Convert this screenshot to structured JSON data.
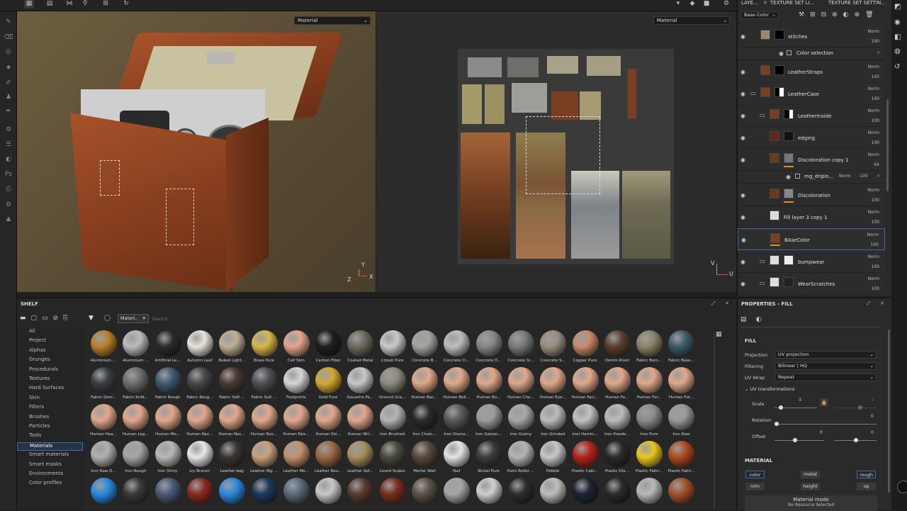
{
  "viewport3d": {
    "mode": "Material"
  },
  "viewport2d": {
    "mode": "Material"
  },
  "axis": {
    "y": "Y",
    "x": "X",
    "z": "Z",
    "u": "U",
    "v": "V"
  },
  "tabs": {
    "layers": "LAYE...",
    "tsl": "TEXTURE SET LI...",
    "tss": "TEXTURE SET SETTIN..."
  },
  "channel_select": "Base Color",
  "layers": [
    {
      "name": "stitches",
      "blend": "Norm",
      "opacity": "100"
    },
    {
      "name": "Color selection"
    },
    {
      "name": "LeatherStraps",
      "blend": "Norm",
      "opacity": "100"
    },
    {
      "name": "LeatherCase",
      "blend": "Norm",
      "opacity": "100"
    },
    {
      "name": "LeatherInside",
      "blend": "Norm",
      "opacity": "100"
    },
    {
      "name": "edging",
      "blend": "Norm",
      "opacity": "100"
    },
    {
      "name": "Discoloration copy 1",
      "blend": "Norm",
      "opacity": "64"
    },
    {
      "name": "mg_dripin...",
      "blend": "Norm",
      "opacity": "100"
    },
    {
      "name": "Discoloration",
      "blend": "Norm",
      "opacity": "100"
    },
    {
      "name": "Fill layer 3 copy 1",
      "blend": "Norm",
      "opacity": "100"
    },
    {
      "name": "BAseColor",
      "blend": "Norm",
      "opacity": "100"
    },
    {
      "name": "bumpwear",
      "blend": "Norm",
      "opacity": "100"
    },
    {
      "name": "WearScratches",
      "blend": "Norm",
      "opacity": "100"
    }
  ],
  "shelf": {
    "title": "SHELF",
    "filter_chip": "Materi..",
    "search_placeholder": "Search...",
    "categories": [
      "All",
      "Project",
      "Alphas",
      "Grunges",
      "Procedurals",
      "Textures",
      "Hard Surfaces",
      "Skin",
      "Filters",
      "Brushes",
      "Particles",
      "Tools",
      "Materials",
      "Smart materials",
      "Smart masks",
      "Environments",
      "Color profiles"
    ],
    "materials": [
      "Aluminium ...",
      "Aluminium ...",
      "Artificial Le...",
      "Autumn Leaf",
      "Baked Light...",
      "Brass Pure",
      "Calf Skin",
      "Carbon Fiber",
      "Coated Metal",
      "Cobalt Pure",
      "Concrete B...",
      "Concrete Cl...",
      "Concrete D...",
      "Concrete Si...",
      "Concrete S...",
      "Copper Pure",
      "Denim Rivet",
      "Fabric Bam...",
      "Fabric Base...",
      "Fabric Deni...",
      "Fabric Knitt...",
      "Fabric Rough",
      "Fabric Roug...",
      "Fabric Soft ...",
      "Fabric Suit ...",
      "Footprints",
      "Gold Pure",
      "Gouache Pa...",
      "Ground Gra...",
      "Human Bac...",
      "Human Bell...",
      "Human Bu...",
      "Human Che...",
      "Human Eye...",
      "Human Faci...",
      "Human Fe...",
      "Human For...",
      "Human For...",
      "Human Hea...",
      "Human Leg...",
      "Human Mo...",
      "Human Nec...",
      "Human Nec...",
      "Human Nos...",
      "Human Nos...",
      "Human Shi...",
      "Human Wri...",
      "Iron Brushed",
      "Iron Chain...",
      "Iron Diamo...",
      "Iron Galvan...",
      "Iron Grainy",
      "Iron Grinded",
      "Iron Hamm...",
      "Iron Powde...",
      "Iron Pure",
      "Iron Raw",
      "Iron Raw D...",
      "Iron Rough",
      "Iron Shiny",
      "Ivy Branch",
      "Leather bag",
      "Leather Big ...",
      "Leather Me...",
      "Leather Rou...",
      "Leather Sof...",
      "Lizard Scales",
      "Mortar Wall",
      "Nail",
      "Nickel Pure",
      "Paint Roller ...",
      "Pebble",
      "Plastic Cabl...",
      "Plastic Dia...",
      "Plastic Fabri...",
      "Plastic Fabri...",
      "",
      "",
      "",
      "",
      "",
      "",
      "",
      "",
      "",
      "",
      "",
      "",
      "",
      "",
      "",
      "",
      "",
      "",
      ""
    ]
  },
  "properties": {
    "title": "PROPERTIES - FILL",
    "fill_heading": "FILL",
    "projection_label": "Projection",
    "projection_value": "UV projection",
    "filtering_label": "Filtering",
    "filtering_value": "Bilinear | HQ",
    "uvwrap_label": "UV Wrap",
    "uvwrap_value": "Repeat",
    "uvt_heading": "UV transformations",
    "scale_label": "Scale",
    "scale_value": "3",
    "scale_value2": "3",
    "rotation_label": "Rotation",
    "rotation_value": "0",
    "offset_label": "Offset",
    "offset_value1": "0",
    "offset_value2": "0",
    "material_heading": "MATERIAL",
    "channels": [
      "color",
      "metal",
      "rough",
      "nrm",
      "height",
      "op"
    ],
    "material_mode": "Material mode",
    "no_resource": "No Resource Selected"
  }
}
